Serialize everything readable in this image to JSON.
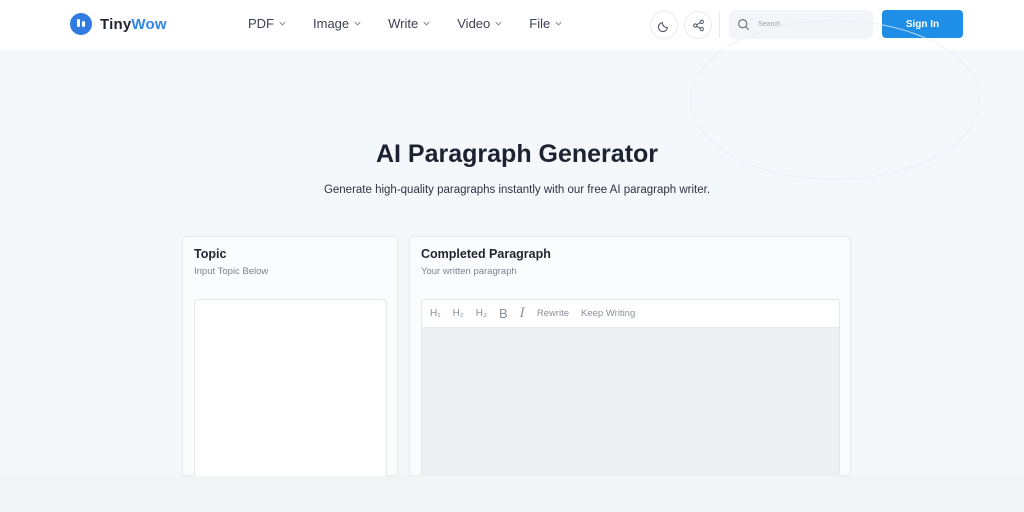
{
  "brand": {
    "name_a": "Tiny",
    "name_b": "Wow",
    "accent_color": "#2f86e6"
  },
  "nav": {
    "items": [
      {
        "label": "PDF"
      },
      {
        "label": "Image"
      },
      {
        "label": "Write"
      },
      {
        "label": "Video"
      },
      {
        "label": "File"
      }
    ]
  },
  "header": {
    "theme_icon": "moon-icon",
    "share_icon": "share-icon",
    "search_placeholder": "Search",
    "signin_label": "Sign In",
    "signin_color": "#1f8ee6"
  },
  "hero": {
    "title": "AI Paragraph Generator",
    "subtitle": "Generate high-quality paragraphs instantly with our free AI paragraph writer."
  },
  "topic_panel": {
    "title": "Topic",
    "subtitle": "Input Topic Below"
  },
  "result_panel": {
    "title": "Completed Paragraph",
    "subtitle": "Your written paragraph",
    "toolbar": {
      "h1": "H₁",
      "h2": "H₂",
      "h3": "H₃",
      "bold": "B",
      "italic": "I",
      "rewrite": "Rewrite",
      "keep_writing": "Keep Writing"
    }
  }
}
